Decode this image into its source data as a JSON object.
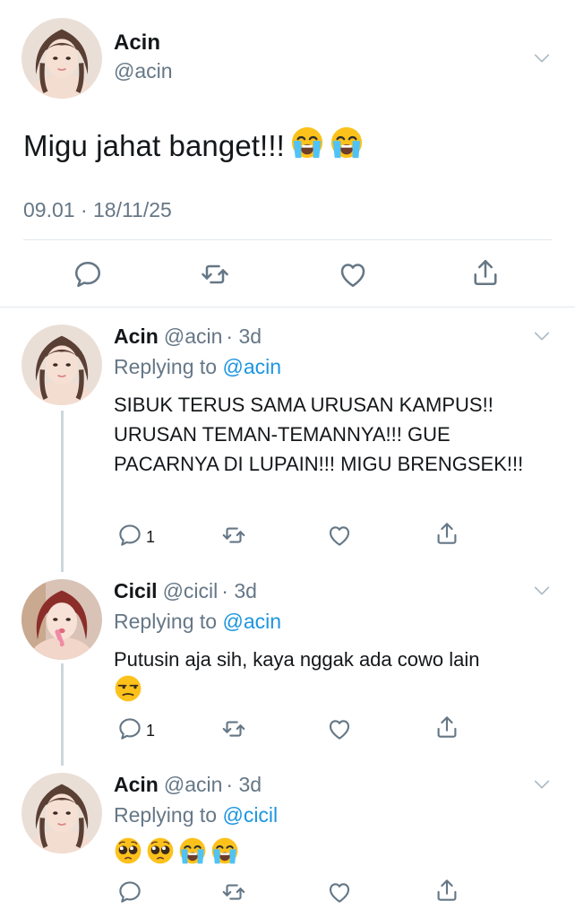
{
  "main_tweet": {
    "name": "Acin",
    "handle": "@acin",
    "text": "Migu jahat banget!!!",
    "emoji_icons": [
      "loudly-crying-face-icon",
      "loudly-crying-face-icon"
    ],
    "timestamp": "09.01 · 18/11/25",
    "actions": [
      "reply-icon",
      "retweet-icon",
      "like-icon",
      "share-icon"
    ]
  },
  "replies": [
    {
      "name": "Acin",
      "handle": "@acin",
      "time": "· 3d",
      "replying_prefix": "Replying to",
      "replying_to": "@acin",
      "text": "SIBUK TERUS SAMA URUSAN KAMPUS!! URUSAN TEMAN-TEMANNYA!!! GUE PACARNYA DI LUPAIN!!! MIGU BRENGSEK!!!",
      "reply_count": "1"
    },
    {
      "name": "Cicil",
      "handle": "@cicil",
      "time": "· 3d",
      "replying_prefix": "Replying to",
      "replying_to": "@acin",
      "text": "Putusin aja sih, kaya nggak ada cowo lain",
      "emoji_icons": [
        "unamused-face-icon"
      ],
      "reply_count": "1"
    },
    {
      "name": "Acin",
      "handle": "@acin",
      "time": "· 3d",
      "replying_prefix": "Replying to",
      "replying_to": "@cicil",
      "text": "",
      "emoji_icons": [
        "pleading-face-icon",
        "pleading-face-icon",
        "loudly-crying-face-icon",
        "loudly-crying-face-icon"
      ],
      "reply_count": ""
    }
  ],
  "colors": {
    "secondary_text": "#657786",
    "link": "#1b95e0",
    "divider": "#e1e8ed",
    "thread_line": "#ccd6dd",
    "icon": "#657786"
  }
}
